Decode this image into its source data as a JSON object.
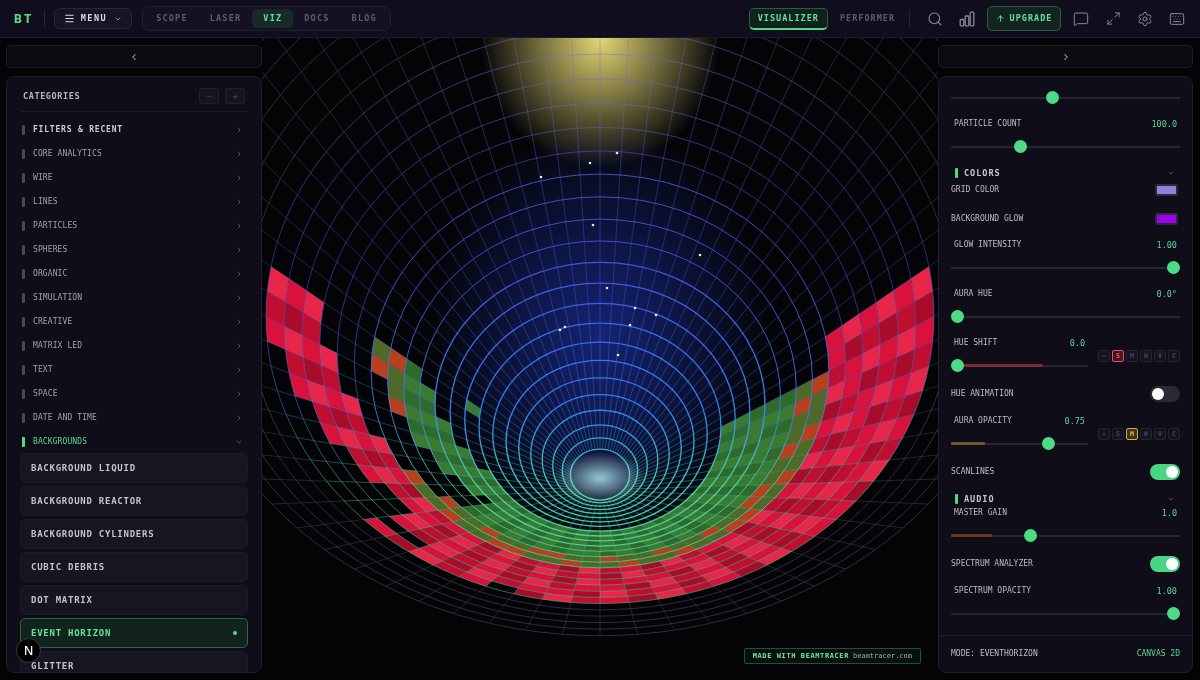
{
  "top_bar": {
    "logo": "BT",
    "menu": {
      "label": "MENU"
    },
    "nav_tabs": [
      {
        "label": "SCOPE",
        "selected": false
      },
      {
        "label": "LASER",
        "selected": false
      },
      {
        "label": "VIZ",
        "selected": true
      },
      {
        "label": "DOCS",
        "selected": false
      },
      {
        "label": "BLOG",
        "selected": false
      }
    ],
    "view_tabs": [
      {
        "label": "VISUALIZER",
        "selected": true
      },
      {
        "label": "PERFORMER",
        "selected": false
      }
    ],
    "upgrade": {
      "label": "UPGRADE"
    }
  },
  "categories_panel": {
    "title": "CATEGORIES",
    "items": [
      {
        "label": "FILTERS & RECENT",
        "kind": "filters",
        "expanded": false
      },
      {
        "label": "CORE ANALYTICS",
        "kind": "category",
        "expanded": false
      },
      {
        "label": "WIRE",
        "kind": "category",
        "expanded": false
      },
      {
        "label": "LINES",
        "kind": "category",
        "expanded": false
      },
      {
        "label": "PARTICLES",
        "kind": "category",
        "expanded": false
      },
      {
        "label": "SPHERES",
        "kind": "category",
        "expanded": false
      },
      {
        "label": "ORGANIC",
        "kind": "category",
        "expanded": false
      },
      {
        "label": "SIMULATION",
        "kind": "category",
        "expanded": false
      },
      {
        "label": "CREATIVE",
        "kind": "category",
        "expanded": false
      },
      {
        "label": "MATRIX LED",
        "kind": "category",
        "expanded": false
      },
      {
        "label": "TEXT",
        "kind": "category",
        "expanded": false
      },
      {
        "label": "SPACE",
        "kind": "category",
        "expanded": false
      },
      {
        "label": "DATE AND TIME",
        "kind": "category",
        "expanded": false
      },
      {
        "label": "BACKGROUNDS",
        "kind": "category",
        "expanded": true,
        "children": [
          {
            "label": "BACKGROUND LIQUID",
            "selected": false
          },
          {
            "label": "BACKGROUND REACTOR",
            "selected": false
          },
          {
            "label": "BACKGROUND CYLINDERS",
            "selected": false
          },
          {
            "label": "CUBIC DEBRIS",
            "selected": false
          },
          {
            "label": "DOT MATRIX",
            "selected": false
          },
          {
            "label": "EVENT HORIZON",
            "selected": true
          },
          {
            "label": "GLITTER",
            "selected": false
          }
        ]
      }
    ]
  },
  "dev_badge": {
    "label": "N"
  },
  "visualizer": {
    "credit": {
      "text": "MADE WITH BEAMTRACER",
      "link": "beamtracer.com"
    }
  },
  "settings_panel": {
    "rows": [
      {
        "kind": "slider",
        "level": 0.44
      },
      {
        "kind": "slider",
        "label": "PARTICLE COUNT",
        "value": "100.0",
        "level": 0.29
      },
      {
        "kind": "section",
        "label": "COLORS",
        "expanded": true
      },
      {
        "kind": "color",
        "label": "GRID COLOR",
        "color": "#8d85d4"
      },
      {
        "kind": "color",
        "label": "BACKGROUND GLOW",
        "color": "#a000f0"
      },
      {
        "kind": "slider",
        "label": "GLOW INTENSITY",
        "value": "1.00",
        "level": 1
      },
      {
        "kind": "slider",
        "label": "AURA HUE",
        "value": "0.0°",
        "level": 0
      },
      {
        "kind": "mod_slider",
        "label": "HUE SHIFT",
        "value": "0.0",
        "level": 0,
        "modulation": {
          "level": 0.67,
          "color": "#7d2a36"
        },
        "modes": [
          {
            "label": "–",
            "selected": false
          },
          {
            "label": "S",
            "selected": true
          },
          {
            "label": "M",
            "selected": false
          },
          {
            "label": "H",
            "selected": false
          },
          {
            "label": "V",
            "selected": false
          },
          {
            "label": "C",
            "selected": false
          }
        ]
      },
      {
        "kind": "toggle",
        "label": "HUE ANIMATION",
        "on": false
      },
      {
        "kind": "mod_slider",
        "label": "AURA OPACITY",
        "value": "0.75",
        "level": 0.73,
        "modulation": {
          "level": 0.25,
          "color": "#6b5a2c"
        },
        "modes": [
          {
            "label": "–",
            "selected": false
          },
          {
            "label": "S",
            "selected": false
          },
          {
            "label": "M",
            "selected": true
          },
          {
            "label": "H",
            "selected": false
          },
          {
            "label": "V",
            "selected": false
          },
          {
            "label": "C",
            "selected": false
          }
        ]
      },
      {
        "kind": "toggle",
        "label": "SCANLINES",
        "on": true
      },
      {
        "kind": "section",
        "label": "AUDIO",
        "expanded": true
      },
      {
        "kind": "slider",
        "label": "MASTER GAIN",
        "value": "1.0",
        "level": 0.34,
        "modulation": {
          "level": 0.18,
          "color": "#6e3422"
        }
      },
      {
        "kind": "toggle",
        "label": "SPECTRUM ANALYZER",
        "on": true
      },
      {
        "kind": "slider",
        "label": "SPECTRUM OPACITY",
        "value": "1.00",
        "level": 1
      }
    ],
    "footer": {
      "mode": "MODE: EVENTHORIZON",
      "renderer": "CANVAS 2D"
    }
  }
}
